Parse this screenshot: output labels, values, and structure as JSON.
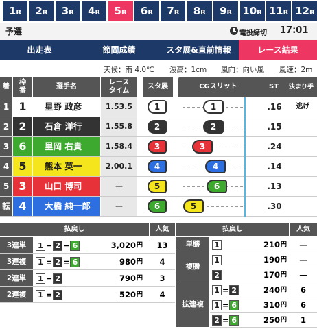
{
  "races": [
    {
      "num": "1",
      "suffix": "R",
      "active": false
    },
    {
      "num": "2",
      "suffix": "R",
      "active": false
    },
    {
      "num": "3",
      "suffix": "R",
      "active": false
    },
    {
      "num": "4",
      "suffix": "R",
      "active": false
    },
    {
      "num": "5",
      "suffix": "R",
      "active": true
    },
    {
      "num": "6",
      "suffix": "R",
      "active": false
    },
    {
      "num": "7",
      "suffix": "R",
      "active": false
    },
    {
      "num": "8",
      "suffix": "R",
      "active": false
    },
    {
      "num": "9",
      "suffix": "R",
      "active": false
    },
    {
      "num": "10",
      "suffix": "R",
      "active": false
    },
    {
      "num": "11",
      "suffix": "R",
      "active": false
    },
    {
      "num": "12",
      "suffix": "R",
      "active": false
    }
  ],
  "header": {
    "race_name": "予選",
    "deadline_label": "電投締切",
    "deadline_time": "17:01"
  },
  "nav": [
    {
      "label": "出走表",
      "active": false
    },
    {
      "label": "節間成績",
      "active": false
    },
    {
      "label": "スタ展&直前情報",
      "active": false
    },
    {
      "label": "レース結果",
      "active": true
    }
  ],
  "weather": {
    "weather_label": "天候：",
    "weather_value": "雨",
    "temp": "4.0℃",
    "wave_label": "波高：",
    "wave_value": "1cm",
    "wind_dir_label": "風向：",
    "wind_dir_value": "向い風",
    "wind_speed_label": "風速：",
    "wind_speed_value": "2m"
  },
  "table_headers": {
    "rank": "着",
    "waku_top": "枠",
    "waku_bottom": "番",
    "name": "選手名",
    "time_top": "レース",
    "time_bottom": "タイム",
    "tenji": "スタ展",
    "cg": "CGスリット",
    "st": "ST",
    "kimarite": "決まり手"
  },
  "results": [
    {
      "rank": "1",
      "waku": "1",
      "name": "星野 政彦",
      "time": "1.53.5",
      "tenji": "1",
      "cg": "1",
      "st": ".16",
      "kimarite": "逃げ"
    },
    {
      "rank": "2",
      "waku": "2",
      "name": "石倉 洋行",
      "time": "1.55.8",
      "tenji": "2",
      "cg": "2",
      "st": ".15",
      "kimarite": ""
    },
    {
      "rank": "3",
      "waku": "6",
      "name": "里岡 右貴",
      "time": "1.58.4",
      "tenji": "3",
      "cg": "3",
      "st": ".24",
      "kimarite": ""
    },
    {
      "rank": "4",
      "waku": "5",
      "name": "熊本 英一",
      "time": "2.00.1",
      "tenji": "4",
      "cg": "4",
      "st": ".14",
      "kimarite": ""
    },
    {
      "rank": "5",
      "waku": "3",
      "name": "山口 博司",
      "time": "—",
      "tenji": "5",
      "cg": "6",
      "st": ".13",
      "kimarite": ""
    },
    {
      "rank": "転",
      "waku": "4",
      "name": "大橋 純一郎",
      "time": "—",
      "tenji": "6",
      "cg": "5",
      "st": ".30",
      "kimarite": ""
    }
  ],
  "payout_headers": {
    "haraimodoshi": "払戻し",
    "ninki": "人気"
  },
  "payouts_left": [
    {
      "type": "3連単",
      "combo": [
        "1",
        "2",
        "6"
      ],
      "seps": [
        "−",
        "−"
      ],
      "amount": "3,020",
      "yen": "円",
      "ninki": "13"
    },
    {
      "type": "3連複",
      "combo": [
        "1",
        "2",
        "6"
      ],
      "seps": [
        "=",
        "="
      ],
      "amount": "980",
      "yen": "円",
      "ninki": "4"
    },
    {
      "type": "2連単",
      "combo": [
        "1",
        "2"
      ],
      "seps": [
        "−"
      ],
      "amount": "790",
      "yen": "円",
      "ninki": "3"
    },
    {
      "type": "2連複",
      "combo": [
        "1",
        "2"
      ],
      "seps": [
        "="
      ],
      "amount": "520",
      "yen": "円",
      "ninki": "4"
    }
  ],
  "payouts_right": [
    {
      "type": "単勝",
      "combo": [
        "1"
      ],
      "seps": [],
      "amount": "210",
      "yen": "円",
      "ninki": "—"
    },
    {
      "type": "複勝",
      "combo": [
        "1"
      ],
      "seps": [],
      "amount": "190",
      "yen": "円",
      "ninki": "—"
    },
    {
      "type": "",
      "combo": [
        "2"
      ],
      "seps": [],
      "amount": "170",
      "yen": "円",
      "ninki": "—"
    },
    {
      "type": "",
      "combo": [
        "1",
        "2"
      ],
      "seps": [
        "="
      ],
      "amount": "240",
      "yen": "円",
      "ninki": "6"
    },
    {
      "type": "拡連複",
      "combo": [
        "1",
        "6"
      ],
      "seps": [
        "="
      ],
      "amount": "310",
      "yen": "円",
      "ninki": "6"
    },
    {
      "type": "",
      "combo": [
        "2",
        "6"
      ],
      "seps": [
        "="
      ],
      "amount": "250",
      "yen": "円",
      "ninki": "1"
    }
  ],
  "colors": {
    "navy": "#1c3968",
    "pink": "#ee3663",
    "w1": "#ffffff",
    "w2": "#333333",
    "w3": "#e8323a",
    "w4": "#2d6ee0",
    "w5": "#f5e51c",
    "w6": "#3ea92f"
  }
}
